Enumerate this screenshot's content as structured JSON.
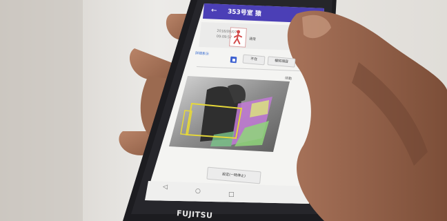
{
  "screen": {
    "header_title": "353号室 猿",
    "back_icon": "arrow-left-icon",
    "date_line1": "2018/09/07",
    "date_line2": "09:09:57",
    "status_label": "通常",
    "link_label": "詳細表示",
    "button_left": "不在",
    "button_right": "検知項目",
    "image_corner_label": "体動",
    "bottom_button": "設定(一時停止)"
  },
  "device": {
    "brand": "FUJITSU",
    "nav_back_icon": "triangle-back-icon",
    "nav_home_icon": "circle-home-icon",
    "nav_recent_icon": "square-recent-icon"
  },
  "colors": {
    "header": "#4b3fb6",
    "phone_body": "#1e1e22",
    "highlight": "#e6d83a",
    "accent_blue": "#3b5fd0"
  }
}
